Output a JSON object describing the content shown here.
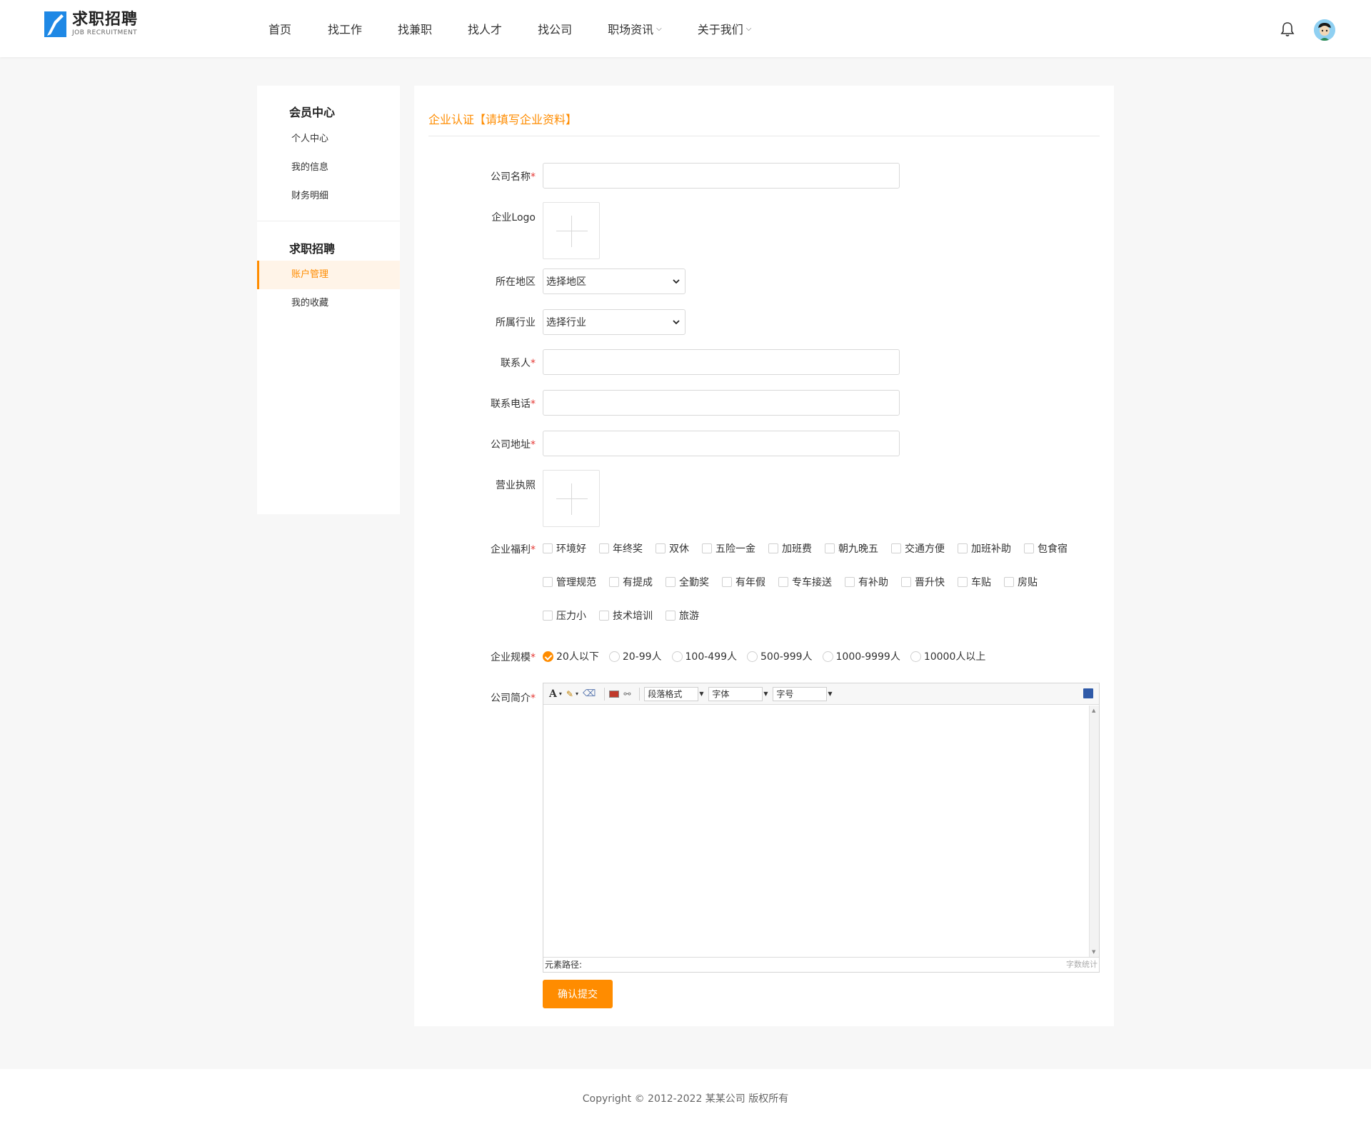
{
  "brand": {
    "title": "求职招聘",
    "subtitle": "JOB RECRUITMENT"
  },
  "nav": [
    "首页",
    "找工作",
    "找兼职",
    "找人才",
    "找公司",
    "职场资讯",
    "关于我们"
  ],
  "sidebar": {
    "group1": {
      "title": "会员中心",
      "items": [
        "个人中心",
        "我的信息",
        "财务明细"
      ]
    },
    "group2": {
      "title": "求职招聘",
      "items": [
        "账户管理",
        "我的收藏"
      ],
      "active": "账户管理"
    }
  },
  "form": {
    "title": "企业认证【请填写企业资料】",
    "labels": {
      "company_name": "公司名称",
      "logo": "企业Logo",
      "region": "所在地区",
      "industry": "所属行业",
      "contact": "联系人",
      "phone": "联系电话",
      "address": "公司地址",
      "license": "营业执照",
      "welfare": "企业福利",
      "scale": "企业规模",
      "intro": "公司简介"
    },
    "region_value": "选择地区",
    "industry_value": "选择行业",
    "welfare_options": [
      [
        "环境好",
        "年终奖",
        "双休",
        "五险一金",
        "加班费",
        "朝九晚五",
        "交通方便",
        "加班补助",
        "包食宿"
      ],
      [
        "管理规范",
        "有提成",
        "全勤奖",
        "有年假",
        "专车接送",
        "有补助",
        "晋升快",
        "车贴",
        "房贴"
      ],
      [
        "压力小",
        "技术培训",
        "旅游"
      ]
    ],
    "scale_options": [
      "20人以下",
      "20-99人",
      "100-499人",
      "500-999人",
      "1000-9999人",
      "10000人以上"
    ],
    "scale_selected": "20人以下",
    "editor": {
      "paragraph": "段落格式",
      "font": "字体",
      "size": "字号",
      "path_label": "元素路径:",
      "word_count": "字数统计"
    },
    "submit": "确认提交"
  },
  "footer": "Copyright © 2012-2022 某某公司 版权所有",
  "colors": {
    "accent": "#ff8c00",
    "brand": "#1e88e5"
  }
}
